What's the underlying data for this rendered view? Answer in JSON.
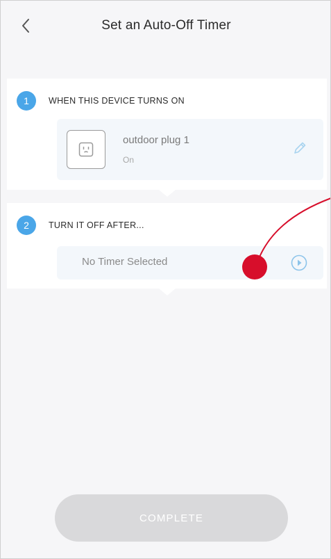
{
  "header": {
    "title": "Set an Auto-Off Timer",
    "back_icon": "chevron-left-icon"
  },
  "step1": {
    "number": "1",
    "label": "WHEN THIS DEVICE TURNS ON",
    "device": {
      "name": "outdoor plug 1",
      "state": "On",
      "icon": "plug-icon",
      "edit_icon": "pencil-icon"
    }
  },
  "step2": {
    "number": "2",
    "label": "TURN IT OFF AFTER...",
    "timer": {
      "value": "No Timer Selected",
      "icon": "chevron-right-circle-icon"
    }
  },
  "footer": {
    "complete_label": "COMPLETE"
  },
  "colors": {
    "accent": "#4aa6e8",
    "annotation": "#d70e2b",
    "button_disabled": "#d9d9db"
  }
}
